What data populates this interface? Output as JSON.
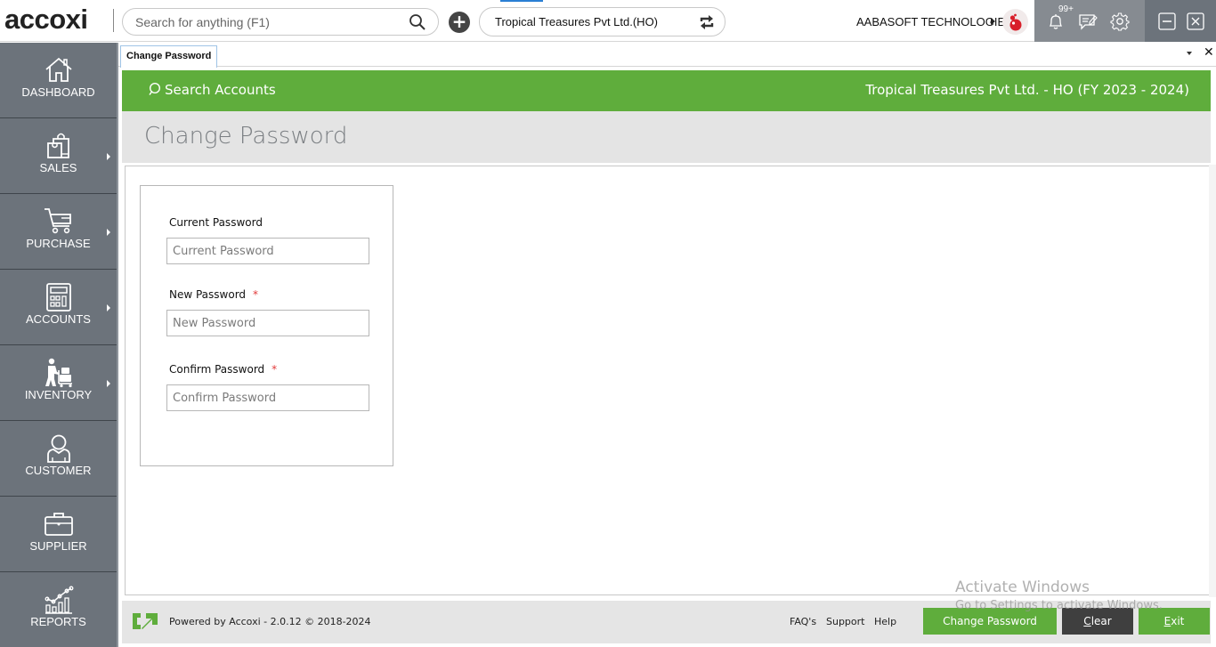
{
  "topbar": {
    "logo_text": "accoxi",
    "search_placeholder": "Search for anything (F1)",
    "company_selector": "Tropical Treasures Pvt Ltd.(HO)",
    "organization": "AABASOFT TECHNOLOGIES",
    "notification_badge": "99+",
    "icons": {
      "search": "search-icon",
      "add": "plus-circle-icon",
      "refresh": "sync-icon",
      "notifications": "bell-icon",
      "messages": "message-edit-icon",
      "settings": "gear-icon",
      "minimize": "minimize-icon",
      "close": "close-icon"
    }
  },
  "sidebar": {
    "items": [
      {
        "label": "DASHBOARD",
        "icon": "home-icon",
        "has_submenu": false
      },
      {
        "label": "SALES",
        "icon": "shopping-bags-icon",
        "has_submenu": true
      },
      {
        "label": "PURCHASE",
        "icon": "cart-icon",
        "has_submenu": true
      },
      {
        "label": "ACCOUNTS",
        "icon": "calculator-icon",
        "has_submenu": true
      },
      {
        "label": "INVENTORY",
        "icon": "trolley-worker-icon",
        "has_submenu": true
      },
      {
        "label": "CUSTOMER",
        "icon": "user-icon",
        "has_submenu": false
      },
      {
        "label": "SUPPLIER",
        "icon": "briefcase-icon",
        "has_submenu": false
      },
      {
        "label": "REPORTS",
        "icon": "chart-icon",
        "has_submenu": false
      }
    ]
  },
  "tabs": {
    "active": "Change Password"
  },
  "header": {
    "search_accounts": "Search Accounts",
    "company_title": "Tropical Treasures Pvt Ltd. - HO (FY 2023 - 2024)",
    "page_title": "Change Password"
  },
  "form": {
    "fields": [
      {
        "label": "Current Password",
        "placeholder": "Current Password",
        "value": "",
        "required": false
      },
      {
        "label": "New Password",
        "placeholder": "New Password",
        "value": "",
        "required": true
      },
      {
        "label": "Confirm Password",
        "placeholder": "Confirm Password",
        "value": "",
        "required": true
      }
    ],
    "required_marker": "*"
  },
  "footer": {
    "powered_by": "Powered by Accoxi - 2.0.12 © 2018-2024",
    "links": [
      "FAQ's",
      "Support",
      "Help"
    ],
    "buttons": {
      "change_password": "Change Password",
      "clear_accel": "C",
      "clear_rest": "lear",
      "exit_accel": "E",
      "exit_rest": "xit"
    }
  },
  "watermark": {
    "line1": "Activate Windows",
    "line2": "Go to Settings to activate Windows."
  },
  "colors": {
    "brand_green": "#5fad3c",
    "sidebar_bg": "#6c737b",
    "tray_bg": "#868b91",
    "dark_button": "#3f3f3f",
    "required": "#e23b3b"
  }
}
